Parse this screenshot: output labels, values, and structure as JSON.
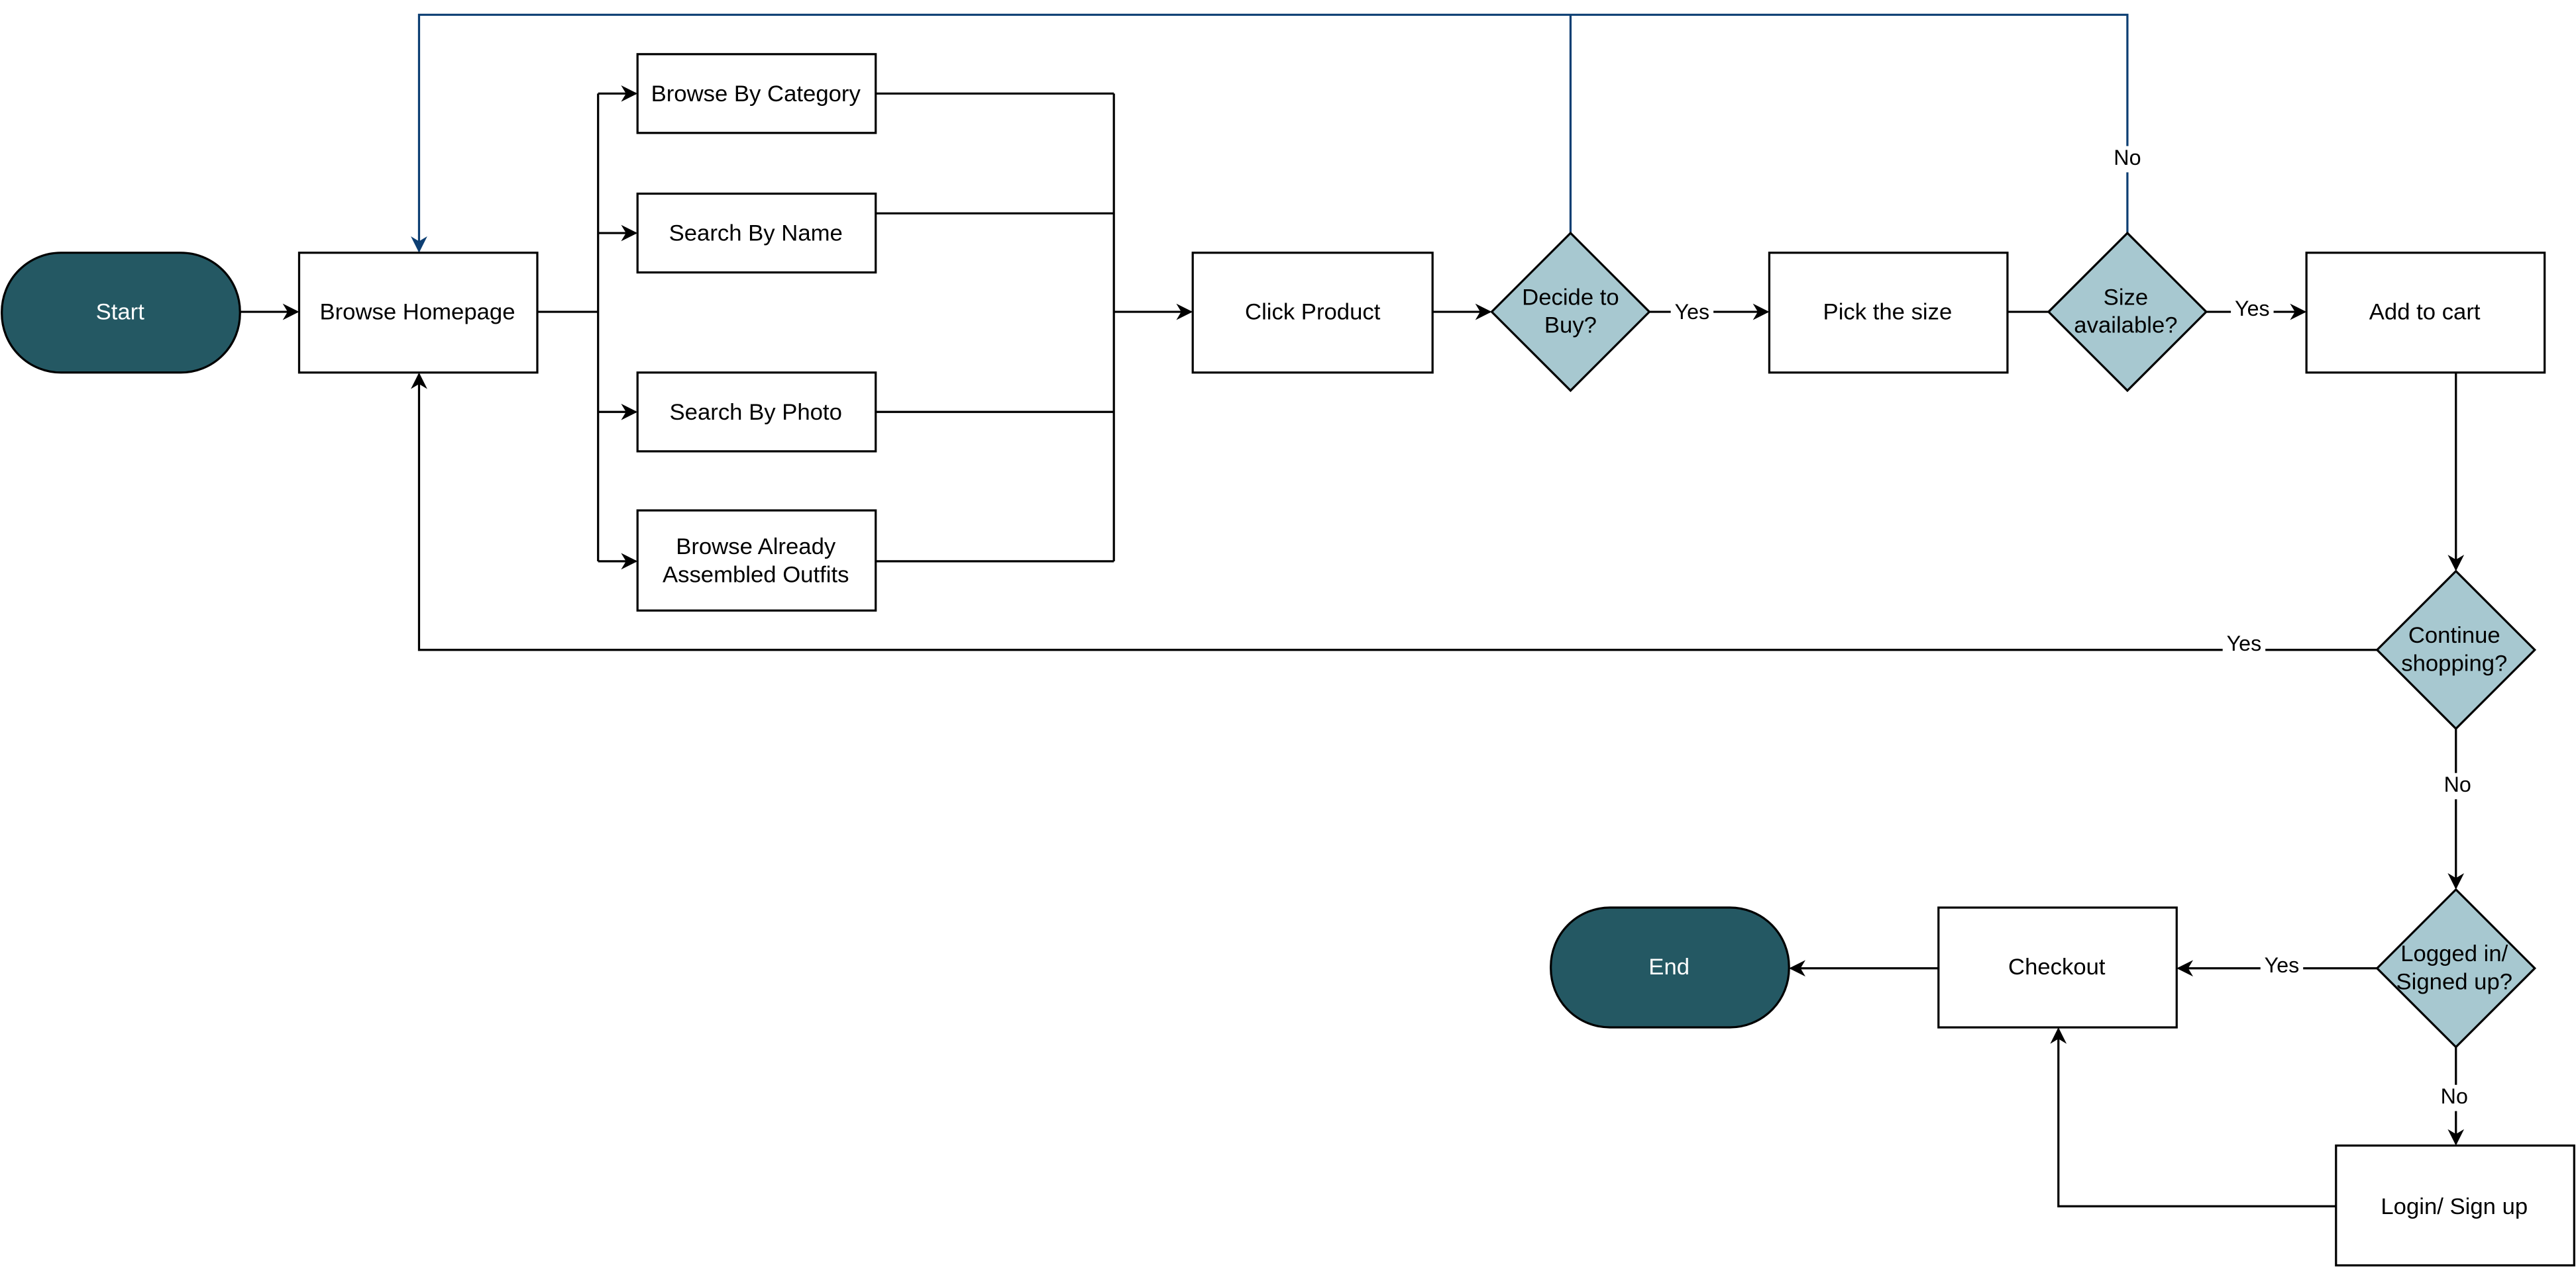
{
  "colors": {
    "terminal_fill": "#245863",
    "decision_fill": "#a7c8d0",
    "process_fill": "#ffffff",
    "loop_edge": "#0d3f73",
    "edge": "#000000"
  },
  "nodes": {
    "start": {
      "label": "Start"
    },
    "browse_homepage": {
      "label": "Browse Homepage"
    },
    "browse_category": {
      "label": "Browse By Category"
    },
    "search_name": {
      "label": "Search By Name"
    },
    "search_photo": {
      "label": "Search By Photo"
    },
    "browse_outfits": {
      "lines": [
        "Browse Already",
        "Assembled Outfits"
      ]
    },
    "click_product": {
      "label": "Click Product"
    },
    "decide_buy": {
      "lines": [
        "Decide to",
        "Buy?"
      ]
    },
    "pick_size": {
      "label": "Pick the size"
    },
    "size_available": {
      "lines": [
        "Size",
        "available?"
      ]
    },
    "add_to_cart": {
      "label": "Add to cart"
    },
    "continue_shopping": {
      "lines": [
        "Continue",
        "shopping?"
      ]
    },
    "logged_in": {
      "lines": [
        "Logged in/",
        "Signed up?"
      ]
    },
    "checkout": {
      "label": "Checkout"
    },
    "end": {
      "label": "End"
    },
    "login": {
      "label": "Login/ Sign up"
    }
  },
  "edge_labels": {
    "decide_yes": "Yes",
    "size_yes": "Yes",
    "size_no": "No",
    "continue_yes": "Yes",
    "continue_no": "No",
    "logged_yes": "Yes",
    "logged_no": "No"
  }
}
